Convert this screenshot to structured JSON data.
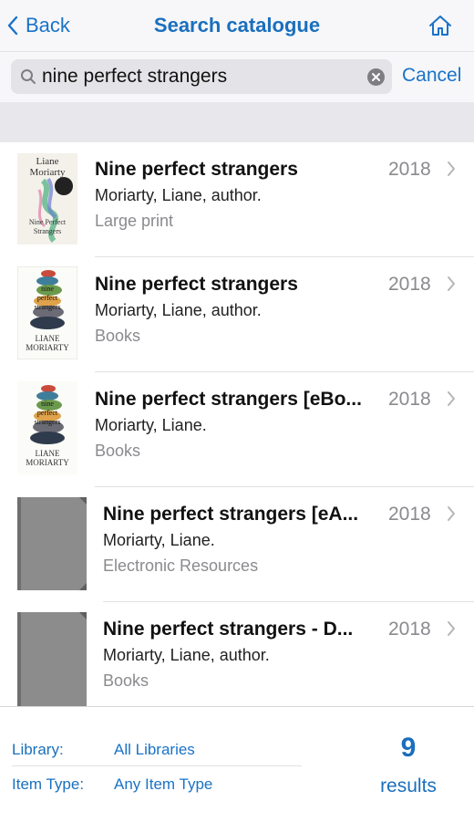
{
  "nav": {
    "back_label": "Back",
    "title": "Search catalogue",
    "home_icon": "home-icon"
  },
  "search": {
    "value": "nine perfect strangers",
    "cancel_label": "Cancel"
  },
  "results": [
    {
      "title": "Nine perfect strangers",
      "author": "Moriarty, Liane, author.",
      "format": "Large print",
      "year": "2018",
      "cover": "liane-cover",
      "cover_text": [
        "Liane",
        "Moriarty",
        "Nine Perfect",
        "Strangers"
      ]
    },
    {
      "title": "Nine perfect strangers",
      "author": "Moriarty, Liane, author.",
      "format": "Books",
      "year": "2018",
      "cover": "stones-cover",
      "cover_text": [
        "nine",
        "perfect",
        "strangers",
        "LIANE",
        "MORIARTY"
      ]
    },
    {
      "title": "Nine perfect strangers [eBo...",
      "author": "Moriarty, Liane.",
      "format": "Books",
      "year": "2018",
      "cover": "stones-cover",
      "cover_text": [
        "nine",
        "perfect",
        "strangers",
        "LIANE",
        "MORIARTY"
      ]
    },
    {
      "title": "Nine perfect strangers [eA...",
      "author": "Moriarty, Liane.",
      "format": "Electronic Resources",
      "year": "2018",
      "cover": "placeholder-cover"
    },
    {
      "title": "Nine perfect strangers - D...",
      "author": "Moriarty, Liane, author.",
      "format": "Books",
      "year": "2018",
      "cover": "placeholder-cover"
    }
  ],
  "footer": {
    "library_label": "Library:",
    "library_value": "All Libraries",
    "item_type_label": "Item Type:",
    "item_type_value": "Any Item Type",
    "count": "9",
    "count_label": "results"
  },
  "colors": {
    "accent": "#1a73c7",
    "secondary_text": "#8a8a8f"
  }
}
